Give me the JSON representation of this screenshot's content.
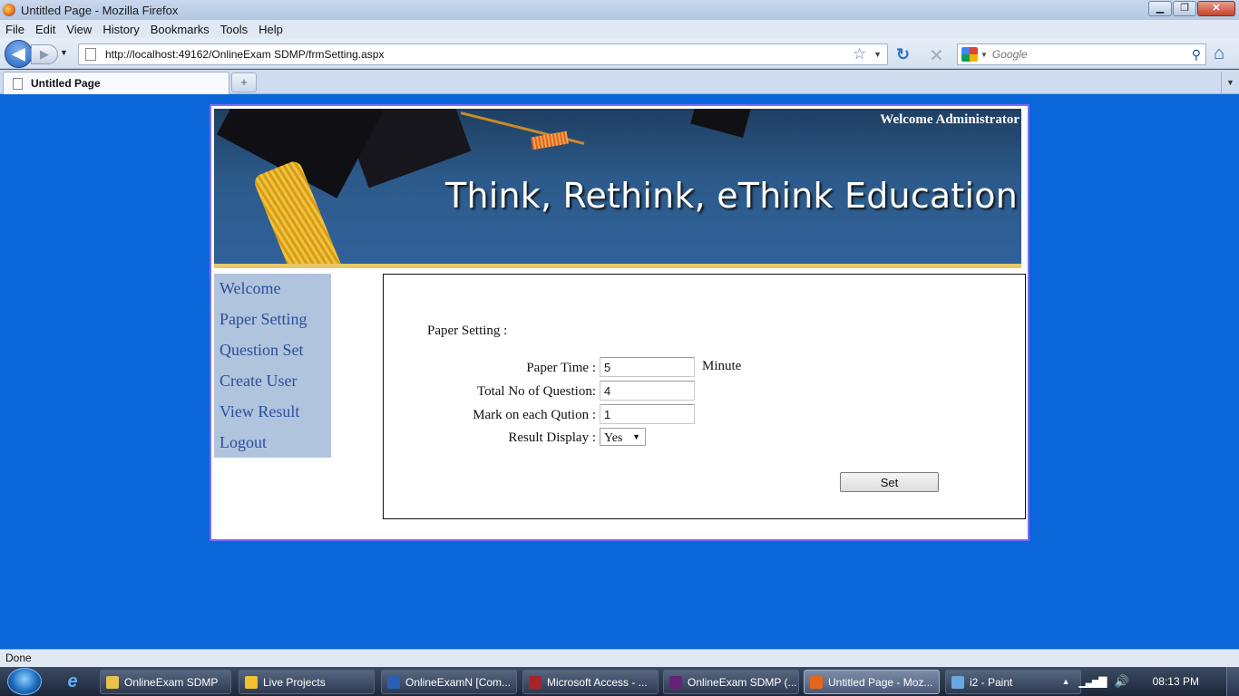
{
  "window": {
    "title": "Untitled Page - Mozilla Firefox",
    "controls": {
      "minimize": "▁",
      "maximize": "❐",
      "close": "✕"
    }
  },
  "menu": [
    "File",
    "Edit",
    "View",
    "History",
    "Bookmarks",
    "Tools",
    "Help"
  ],
  "nav": {
    "back_icon": "◀",
    "forward_icon": "▶",
    "url": "http://localhost:49162/OnlineExam SDMP/frmSetting.aspx",
    "search_placeholder": "Google",
    "reload_icon": "↻",
    "stop_icon": "✕",
    "home_icon": "⌂"
  },
  "tabs": [
    {
      "label": "Untitled Page",
      "active": true
    }
  ],
  "newtab_icon": "+",
  "page": {
    "welcome_text": "Welcome Administrator",
    "tagline": "Think, Rethink, eThink Education",
    "side_menu": [
      "Welcome",
      "Paper Setting",
      "Question Set",
      "Create User",
      "View Result",
      "Logout"
    ],
    "form": {
      "section_title": "Paper Setting :",
      "paper_time_label": "Paper Time :",
      "paper_time_value": "5",
      "paper_time_unit": "Minute",
      "total_questions_label": "Total No of Question:",
      "total_questions_value": "4",
      "mark_label": "Mark on each Qution :",
      "mark_value": "1",
      "result_display_label": "Result Display :",
      "result_display_value": "Yes",
      "set_button": "Set"
    }
  },
  "status": "Done",
  "taskbar": {
    "items": [
      {
        "label": "OnlineExam SDMP",
        "icon_color": "#e8c34a"
      },
      {
        "label": "Live Projects",
        "icon_color": "#f2c12e"
      },
      {
        "label": "OnlineExamN [Com...",
        "icon_color": "#2b5fb4"
      },
      {
        "label": "Microsoft Access - ...",
        "icon_color": "#a4262c"
      },
      {
        "label": "OnlineExam SDMP (...",
        "icon_color": "#68217a"
      },
      {
        "label": "Untitled Page - Moz...",
        "icon_color": "#e5661b",
        "active": true
      },
      {
        "label": "i2 - Paint",
        "icon_color": "#6aa9e0"
      }
    ],
    "clock": "08:13 PM"
  },
  "colors": {
    "page_background": "#0a66d8",
    "frame_border": "#7c6bff",
    "side_menu_bg": "#b0c4de",
    "side_menu_link": "#2a4e9a",
    "banner_stripe": "#e6c86a"
  }
}
